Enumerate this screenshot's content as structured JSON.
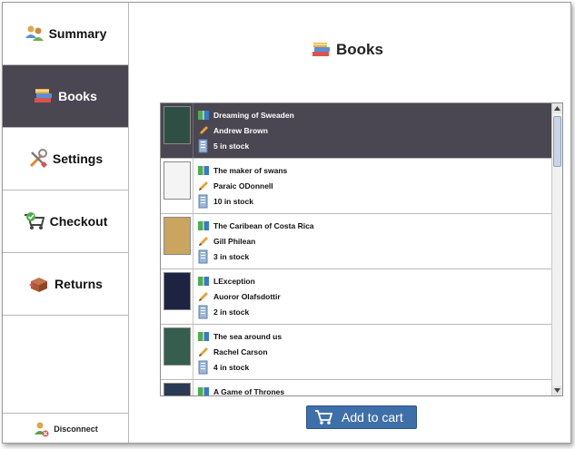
{
  "nav": {
    "items": [
      {
        "label": "Summary",
        "icon": "users-icon"
      },
      {
        "label": "Books",
        "icon": "books-icon",
        "active": true
      },
      {
        "label": "Settings",
        "icon": "tools-icon"
      },
      {
        "label": "Checkout",
        "icon": "cart-check-icon"
      },
      {
        "label": "Returns",
        "icon": "return-box-icon"
      }
    ],
    "disconnect_label": "Disconnect"
  },
  "main": {
    "title": "Books",
    "add_to_cart_label": "Add to cart"
  },
  "books": [
    {
      "title": "Dreaming of Sweaden",
      "author": "Andrew Brown",
      "stock": "5 in stock",
      "selected": true,
      "cover_color": "#2f4f45"
    },
    {
      "title": "The maker of swans",
      "author": "Paraic ODonnell",
      "stock": "10 in stock",
      "cover_color": "#f4f4f4"
    },
    {
      "title": "The Caribean of Costa Rica",
      "author": "Gill Philean",
      "stock": "3 in stock",
      "cover_color": "#caa560"
    },
    {
      "title": "LException",
      "author": "Auoror Olafsdottir",
      "stock": "2 in stock",
      "cover_color": "#1d2340"
    },
    {
      "title": "The sea around us",
      "author": "Rachel Carson",
      "stock": "4 in stock",
      "cover_color": "#355e4f"
    },
    {
      "title": "A Game of Thrones",
      "author": "",
      "stock": "",
      "cover_color": "#2a3a52"
    }
  ],
  "colors": {
    "sidebar_active": "#4a4752",
    "button_blue": "#3f6fa9"
  }
}
